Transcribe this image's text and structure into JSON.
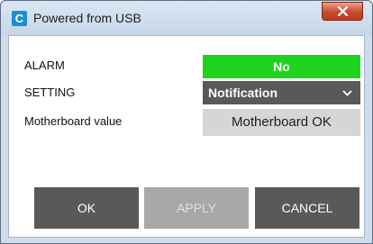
{
  "window": {
    "title": "Powered from USB",
    "app_icon_letter": "C",
    "close_icon": "close-x-icon"
  },
  "rows": [
    {
      "label": "ALARM",
      "value": "No",
      "value_color": "#1ed31e"
    },
    {
      "label": "SETTING",
      "value": "Notification",
      "dropdown_icon": "chevron-down-icon"
    },
    {
      "label": "Motherboard value",
      "value": "Motherboard OK"
    }
  ],
  "buttons": {
    "ok": "OK",
    "apply": "APPLY",
    "cancel": "CANCEL"
  },
  "colors": {
    "accent_green": "#1ed31e",
    "button_dark": "#595959",
    "button_disabled": "#a8a8a8"
  }
}
